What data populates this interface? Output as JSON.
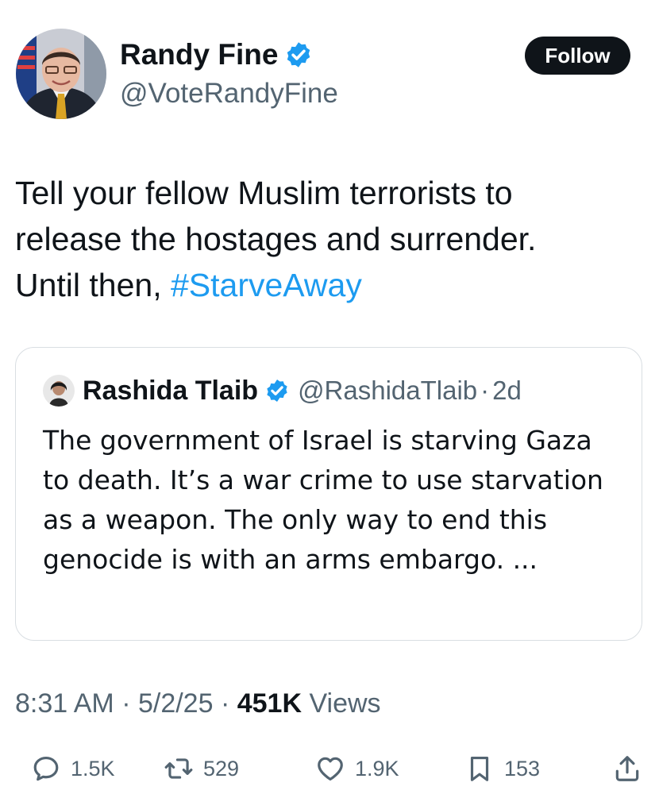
{
  "author": {
    "name": "Randy Fine",
    "handle": "@VoteRandyFine",
    "verified": true
  },
  "follow_button": {
    "label": "Follow"
  },
  "tweet": {
    "text_line1": "Tell your fellow Muslim terrorists to",
    "text_line2": "release the hostages and surrender.",
    "text_line3_prefix": "Until then, ",
    "hashtag": "#StarveAway"
  },
  "quote": {
    "name": "Rashida Tlaib",
    "handle": "@RashidaTlaib",
    "separator": "·",
    "age": "2d",
    "verified": true,
    "text": "The government of Israel is starving Gaza to death. It’s a war crime to use starvation as a weapon. The only way to end this genocide is with an arms embargo. ..."
  },
  "meta": {
    "time": "8:31 AM",
    "separator": " · ",
    "date": "5/2/25",
    "views_count": "451K",
    "views_label": " Views"
  },
  "actions": {
    "reply": {
      "icon": "reply-icon",
      "count": "1.5K"
    },
    "retweet": {
      "icon": "retweet-icon",
      "count": "529"
    },
    "like": {
      "icon": "heart-icon",
      "count": "1.9K"
    },
    "bookmark": {
      "icon": "bookmark-icon",
      "count": "153"
    },
    "share": {
      "icon": "share-icon"
    }
  },
  "colors": {
    "link": "#1d9bf0",
    "verified": "#1d9bf0",
    "secondary_text": "#536471",
    "primary_text": "#0f1419"
  }
}
